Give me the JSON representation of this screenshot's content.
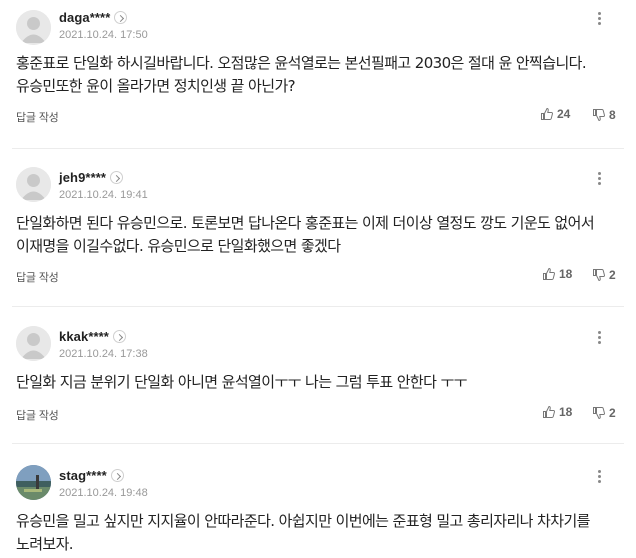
{
  "comments": [
    {
      "username": "daga****",
      "date": "2021.10.24. 17:50",
      "text": "홍준표로 단일화 하시길바랍니다. 오점많은 윤석열로는 본선필패고 2030은 절대 윤 안찍습니다. 유승민또한 윤이 올라가면 정치인생 끝 아닌가?",
      "reply_label": "답글 작성",
      "likes": "24",
      "dislikes": "8",
      "avatar": "default"
    },
    {
      "username": "jeh9****",
      "date": "2021.10.24. 19:41",
      "text": "단일화하면 된다 유승민으로. 토론보면 답나온다 홍준표는 이제 더이상 열정도 깡도 기운도 없어서 이재명을 이길수없다. 유승민으로 단일화했으면 좋겠다",
      "reply_label": "답글 작성",
      "likes": "18",
      "dislikes": "2",
      "avatar": "default"
    },
    {
      "username": "kkak****",
      "date": "2021.10.24. 17:38",
      "text": "단일화 지금 분위기 단일화 아니면 윤석열이ㅜㅜ 나는 그럼 투표 안한다 ㅜㅜ",
      "reply_label": "답글 작성",
      "likes": "18",
      "dislikes": "2",
      "avatar": "default"
    },
    {
      "username": "stag****",
      "date": "2021.10.24. 19:48",
      "text": "유승민을 밀고 싶지만 지지율이 안따라준다. 아쉽지만 이번에는 준표형 밀고 총리자리나 차차기를 노려보자.",
      "avatar": "photo"
    }
  ],
  "icons": {
    "like": "thumbs-up-icon",
    "dislike": "thumbs-down-icon",
    "more": "more-vertical-icon",
    "profile_arrow": "chevron-right-icon"
  },
  "colors": {
    "text": "#222222",
    "meta": "#999999",
    "count": "#666666",
    "divider": "#ececec"
  }
}
